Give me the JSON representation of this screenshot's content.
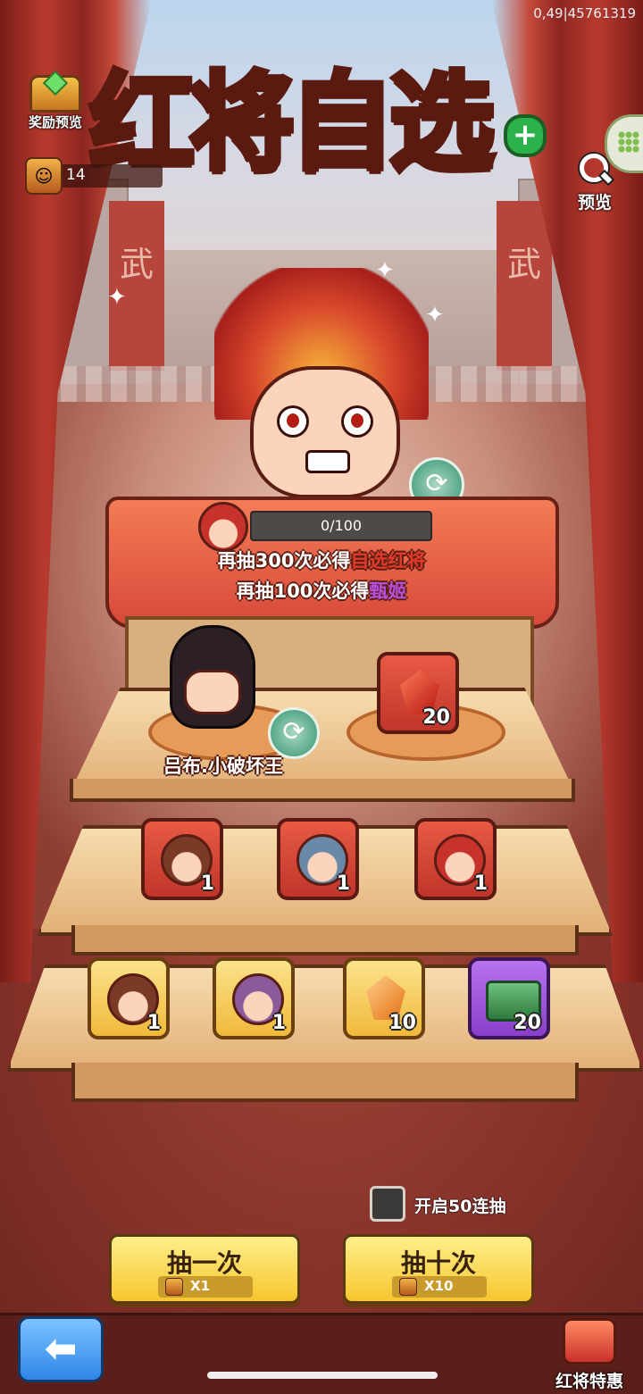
{
  "header": {
    "debug_id": "0,49|45761319",
    "title": "红将自选",
    "title_plus": "+"
  },
  "reward_preview": {
    "label": "奖励预览",
    "icon": "treasure-chest-icon"
  },
  "token": {
    "count": "14",
    "icon": "hero-token-icon"
  },
  "preview": {
    "label": "预览",
    "icon": "magnifier-icon"
  },
  "side_menu": {
    "icon": "grid-menu-icon"
  },
  "background": {
    "banner_char": "武"
  },
  "progress": {
    "current": 0,
    "max": 100,
    "text": "0/100",
    "fill_fraction": 0.0
  },
  "hints": {
    "line1_prefix": "再抽300次必得",
    "line1_highlight": "自选红将",
    "line2_prefix": "再抽100次必得",
    "line2_highlight": "甄姬"
  },
  "featured": {
    "name": "吕布.小破坏王",
    "reward_count": "20"
  },
  "shelf_middle": [
    {
      "count": "1",
      "icon": "hero-fragment-icon"
    },
    {
      "count": "1",
      "icon": "hero-fragment-icon"
    },
    {
      "count": "1",
      "icon": "hero-fragment-icon"
    }
  ],
  "shelf_bottom": [
    {
      "count": "1",
      "icon": "hero-fragment-icon"
    },
    {
      "count": "1",
      "icon": "hero-fragment-icon"
    },
    {
      "count": "10",
      "icon": "orange-gem-icon"
    },
    {
      "count": "20",
      "icon": "jade-seal-icon"
    }
  ],
  "controls": {
    "checkbox_label": "开启50连抽",
    "checkbox_checked": false,
    "draw_one": {
      "label": "抽一次",
      "cost": "X1"
    },
    "draw_ten": {
      "label": "抽十次",
      "cost": "X10"
    }
  },
  "footer": {
    "back_icon": "back-arrow-icon",
    "promo_label": "红将特惠"
  },
  "colors": {
    "accent_red": "#e23a2a",
    "accent_purple": "#b84fe0",
    "button_yellow": "#f7c52e",
    "back_blue": "#2f86e8"
  }
}
